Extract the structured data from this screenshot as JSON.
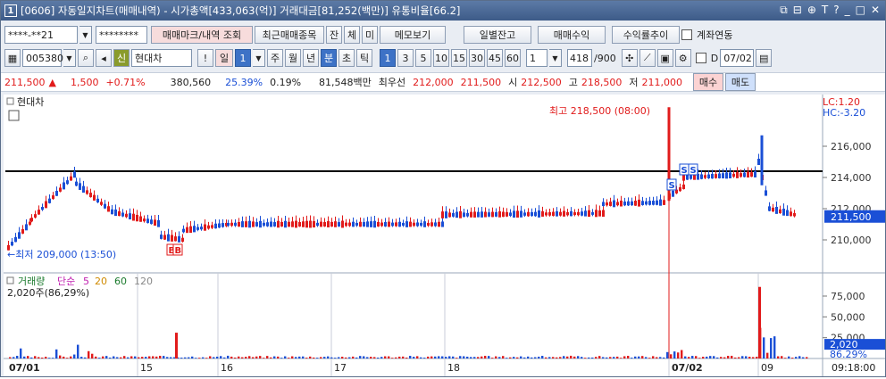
{
  "title": {
    "num": "1",
    "text": "[0606] 자동일지차트(매매내역) - 시가총액[433,063(억)] 거래대금[81,252(백만)] 유통비율[66.2]"
  },
  "title_icons": [
    "⧉",
    "⊟",
    "⊕",
    "T",
    "?",
    "_",
    "□",
    "✕"
  ],
  "toolbar1": {
    "account": "****-**21",
    "password": "********",
    "mark_btn": "매매마크/내역 조회",
    "recent_btn": "최근매매종목",
    "b_jan": "잔",
    "b_che": "체",
    "b_mi": "미",
    "memo_btn": "메모보기",
    "daily_btn": "일별잔고",
    "profit_btn": "매매수익",
    "profit_rate_btn": "수익률추이",
    "link_label": "계좌연동"
  },
  "toolbar2": {
    "code": "005380",
    "stock_name": "현대차",
    "badge": "신",
    "excl": "!",
    "period_label": "일",
    "period_value": "1",
    "periods": [
      "주",
      "월",
      "년",
      "분",
      "초",
      "틱"
    ],
    "intervals": [
      "1",
      "3",
      "5",
      "10",
      "15",
      "30",
      "45",
      "60"
    ],
    "count_select": "1",
    "count": "418",
    "count_total": "/900",
    "d_label": "D",
    "date": "07/02"
  },
  "quote": {
    "price": "211,500",
    "arrow": "▲",
    "change": "1,500",
    "rate": "+0.71%",
    "volume": "380,560",
    "vol_rate": "25.39%",
    "turnover": "0.19%",
    "amount": "81,548백만",
    "best_label": "최우선",
    "bid": "212,000",
    "ask": "211,500",
    "open_label": "시",
    "open": "212,500",
    "high_label": "고",
    "high": "218,500",
    "low_label": "저",
    "low": "211,000",
    "buy_btn": "매수",
    "sell_btn": "매도"
  },
  "chart_data": {
    "type": "candlestick",
    "price_panel": {
      "name": "현대차",
      "y_ticks": [
        "216,000",
        "214,000",
        "212,000",
        "210,000"
      ],
      "current_price": "211,500",
      "lc": "LC:1.20",
      "hc": "HC:-3.20",
      "high_annotation": "최고 218,500 (08:00)",
      "low_annotation": "←최저 209,000 (13:50)",
      "marks": [
        "B",
        "B",
        "S",
        "S",
        "S"
      ],
      "horizontal_line": 214400
    },
    "volume_panel": {
      "label": "거래량",
      "ma_label": "단순",
      "ma": [
        "5",
        "20",
        "60",
        "120"
      ],
      "value_text": "2,020주(86,29%)",
      "y_ticks": [
        "75,000",
        "50,000",
        "25,000"
      ],
      "current_volume": "2,020",
      "current_rate": "86.29%"
    },
    "x_labels": [
      "07/01",
      "15",
      "16",
      "17",
      "18",
      "07/02",
      "09"
    ],
    "time": "09:18:00"
  },
  "colors": {
    "up": "#e11b1b",
    "down": "#1a4fd6",
    "accent": "#3d72c6"
  }
}
